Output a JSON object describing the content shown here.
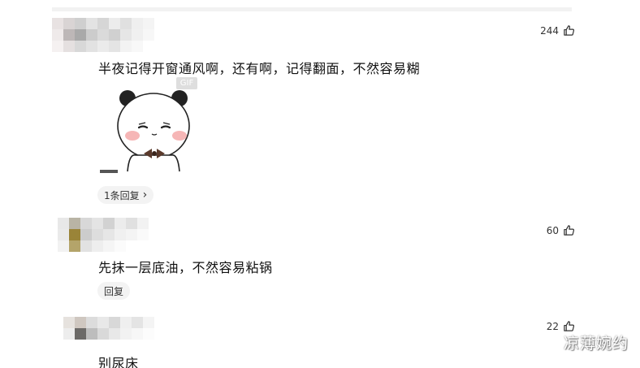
{
  "comments": [
    {
      "likes": "244",
      "text": "半夜记得开窗通风啊，还有啊，记得翻面，不然容易糊",
      "gif_badge": "GIF",
      "sticker_caption": "■■■■",
      "reply_label": "1条回复",
      "reply_chevron": "›"
    },
    {
      "likes": "60",
      "text": "先抹一层底油，不然容易粘锅",
      "reply_label": "回复"
    },
    {
      "likes": "22",
      "text": "别尿床"
    }
  ],
  "watermark": "凉薄婉约",
  "icons": {
    "like": "thumbs-up-icon"
  }
}
